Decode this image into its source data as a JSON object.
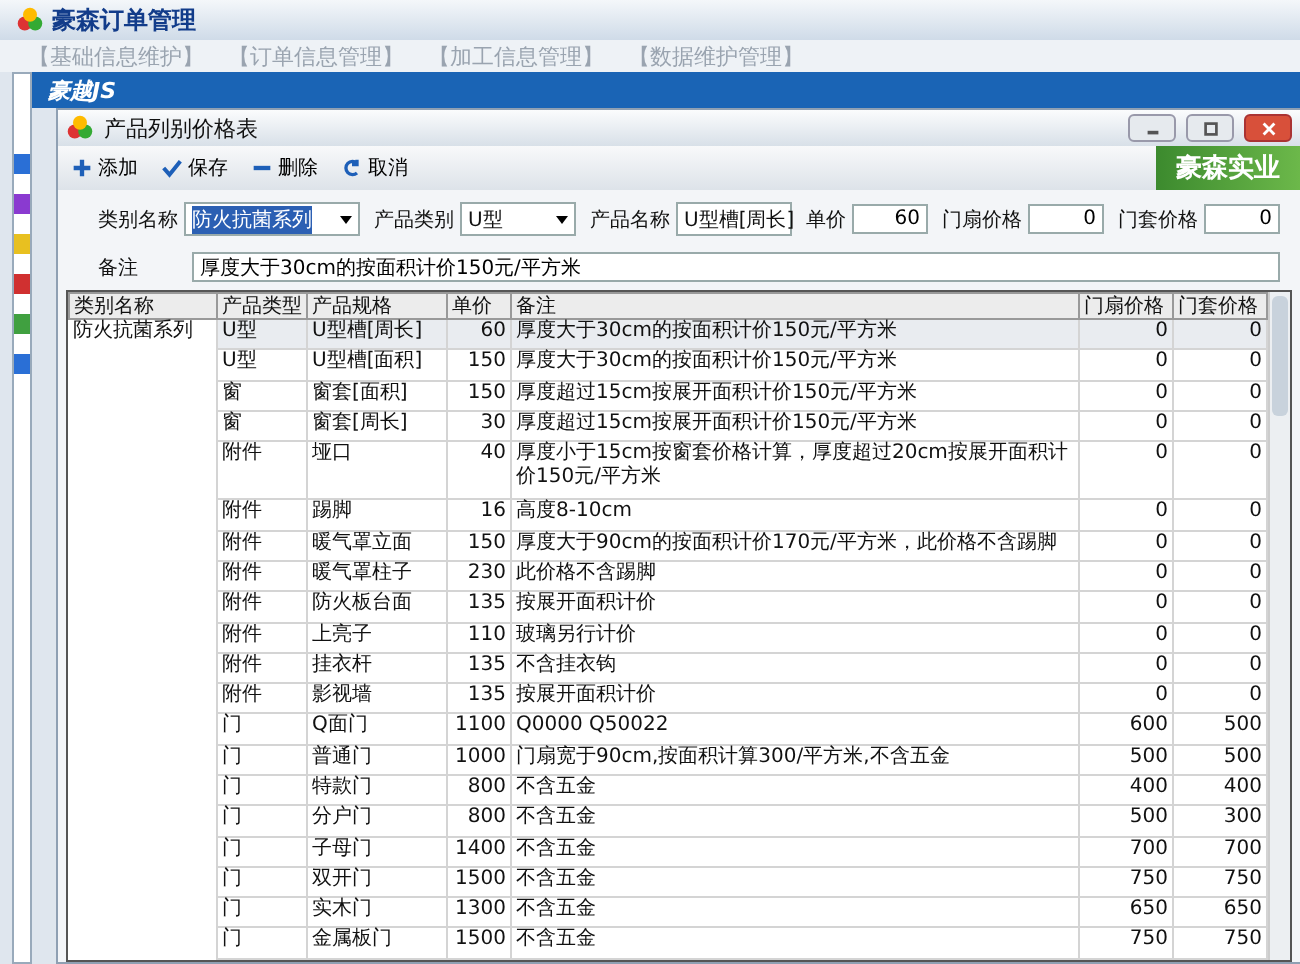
{
  "window": {
    "title": "豪森订单管理"
  },
  "menu": [
    "【基础信息维护】",
    "【订单信息管理】",
    "【加工信息管理】",
    "【数据维护管理】"
  ],
  "banner": {
    "logo": "豪越JS"
  },
  "dialog": {
    "title": "产品列别价格表",
    "brand": "豪森实业"
  },
  "toolbar": [
    {
      "kind": "add",
      "label": "添加"
    },
    {
      "kind": "save",
      "label": "保存"
    },
    {
      "kind": "delete",
      "label": "删除"
    },
    {
      "kind": "cancel",
      "label": "取消"
    }
  ],
  "form": {
    "category": {
      "label": "类别名称",
      "value": "防火抗菌系列"
    },
    "type": {
      "label": "产品类别",
      "value": "U型"
    },
    "name": {
      "label": "产品名称",
      "value": "U型槽[周长]"
    },
    "price": {
      "label": "单价",
      "value": "60"
    },
    "leaf_price": {
      "label": "门扇价格",
      "value": "0"
    },
    "frame_price": {
      "label": "门套价格",
      "value": "0"
    },
    "note": {
      "label": "备注",
      "value": "厚度大于30cm的按面积计价150元/平方米"
    }
  },
  "table": {
    "columns": [
      "类别名称",
      "产品类型",
      "产品规格",
      "单价",
      "备注",
      "门扇价格",
      "门套价格"
    ],
    "rows": [
      {
        "selected": true,
        "cells": [
          "防火抗菌系列",
          "U型",
          "U型槽[周长]",
          "60",
          "厚度大于30cm的按面积计价150元/平方米",
          "0",
          "0"
        ]
      },
      {
        "selected": false,
        "cells": [
          "",
          "U型",
          "U型槽[面积]",
          "150",
          "厚度大于30cm的按面积计价150元/平方米",
          "0",
          "0"
        ]
      },
      {
        "selected": false,
        "cells": [
          "",
          "窗",
          "窗套[面积]",
          "150",
          "厚度超过15cm按展开面积计价150元/平方米",
          "0",
          "0"
        ]
      },
      {
        "selected": false,
        "cells": [
          "",
          "窗",
          "窗套[周长]",
          "30",
          "厚度超过15cm按展开面积计价150元/平方米",
          "0",
          "0"
        ]
      },
      {
        "selected": false,
        "cells": [
          "",
          "附件",
          "垭口",
          "40",
          "厚度小于15cm按窗套价格计算，厚度超过20cm按展开面积计价150元/平方米",
          "0",
          "0"
        ]
      },
      {
        "selected": false,
        "cells": [
          "",
          "附件",
          "踢脚",
          "16",
          "高度8-10cm",
          "0",
          "0"
        ]
      },
      {
        "selected": false,
        "cells": [
          "",
          "附件",
          "暖气罩立面",
          "150",
          "厚度大于90cm的按面积计价170元/平方米，此价格不含踢脚",
          "0",
          "0"
        ]
      },
      {
        "selected": false,
        "cells": [
          "",
          "附件",
          "暖气罩柱子",
          "230",
          "此价格不含踢脚",
          "0",
          "0"
        ]
      },
      {
        "selected": false,
        "cells": [
          "",
          "附件",
          "防火板台面",
          "135",
          "按展开面积计价",
          "0",
          "0"
        ]
      },
      {
        "selected": false,
        "cells": [
          "",
          "附件",
          "上亮子",
          "110",
          "玻璃另行计价",
          "0",
          "0"
        ]
      },
      {
        "selected": false,
        "cells": [
          "",
          "附件",
          "挂衣杆",
          "135",
          "不含挂衣钩",
          "0",
          "0"
        ]
      },
      {
        "selected": false,
        "cells": [
          "",
          "附件",
          "影视墙",
          "135",
          "按展开面积计价",
          "0",
          "0"
        ]
      },
      {
        "selected": false,
        "cells": [
          "",
          "门",
          "Q面门",
          "1100",
          "Q0000 Q50022",
          "600",
          "500"
        ]
      },
      {
        "selected": false,
        "cells": [
          "",
          "门",
          "普通门",
          "1000",
          "门扇宽于90cm,按面积计算300/平方米,不含五金",
          "500",
          "500"
        ]
      },
      {
        "selected": false,
        "cells": [
          "",
          "门",
          "特款门",
          "800",
          "不含五金",
          "400",
          "400"
        ]
      },
      {
        "selected": false,
        "cells": [
          "",
          "门",
          "分户门",
          "800",
          "不含五金",
          "500",
          "300"
        ]
      },
      {
        "selected": false,
        "cells": [
          "",
          "门",
          "子母门",
          "1400",
          "不含五金",
          "700",
          "700"
        ]
      },
      {
        "selected": false,
        "cells": [
          "",
          "门",
          "双开门",
          "1500",
          "不含五金",
          "750",
          "750"
        ]
      },
      {
        "selected": false,
        "cells": [
          "",
          "门",
          "实木门",
          "1300",
          "不含五金",
          "650",
          "650"
        ]
      },
      {
        "selected": false,
        "cells": [
          "",
          "门",
          "金属板门",
          "1500",
          "不含五金",
          "750",
          "750"
        ]
      }
    ]
  }
}
